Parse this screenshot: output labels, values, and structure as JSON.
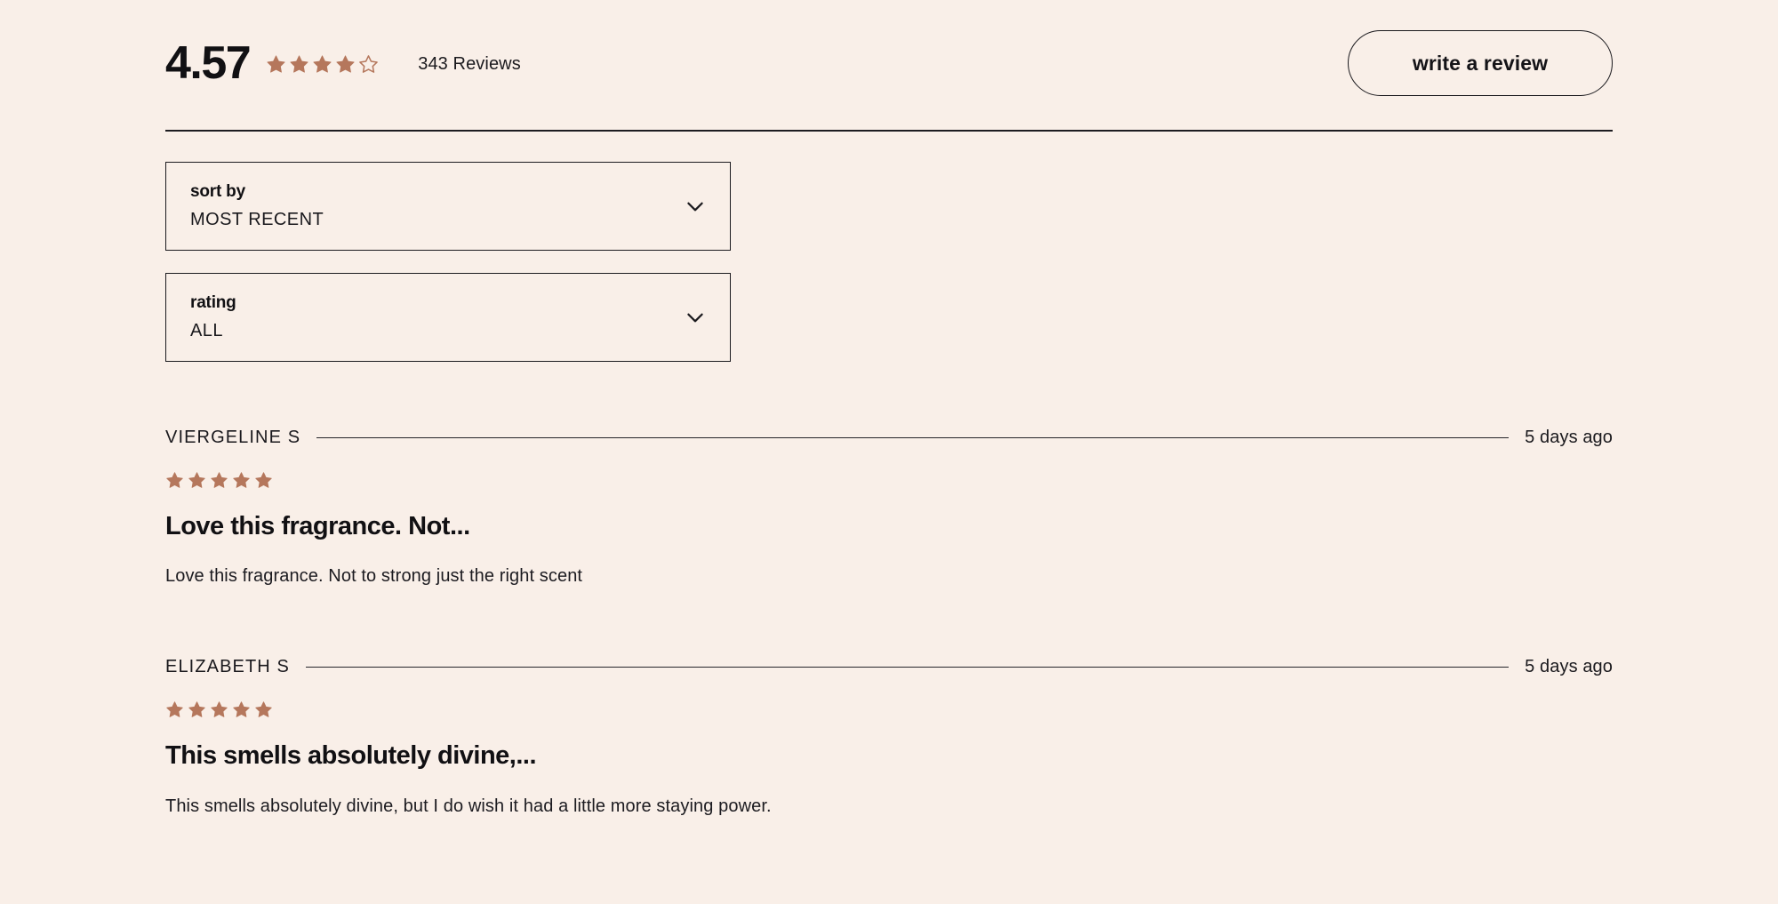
{
  "summary": {
    "average_rating": "4.57",
    "stars_filled": 4,
    "stars_total": 5,
    "review_count_label": "343 Reviews",
    "write_review_label": "write a review",
    "star_color": "#b5775c"
  },
  "filters": [
    {
      "name": "sort-by",
      "label": "sort by",
      "value": "MOST RECENT",
      "icon": "chevron-down-icon"
    },
    {
      "name": "rating",
      "label": "rating",
      "value": "ALL",
      "icon": "chevron-down-icon"
    }
  ],
  "reviews": [
    {
      "author": "VIERGELINE S",
      "date": "5 days ago",
      "stars": 5,
      "title": "Love this fragrance. Not...",
      "body": "Love this fragrance. Not to strong just the right scent"
    },
    {
      "author": "ELIZABETH S",
      "date": "5 days ago",
      "stars": 5,
      "title": "This smells absolutely divine,...",
      "body": "This smells absolutely divine, but I do wish it had a little more staying power."
    }
  ]
}
